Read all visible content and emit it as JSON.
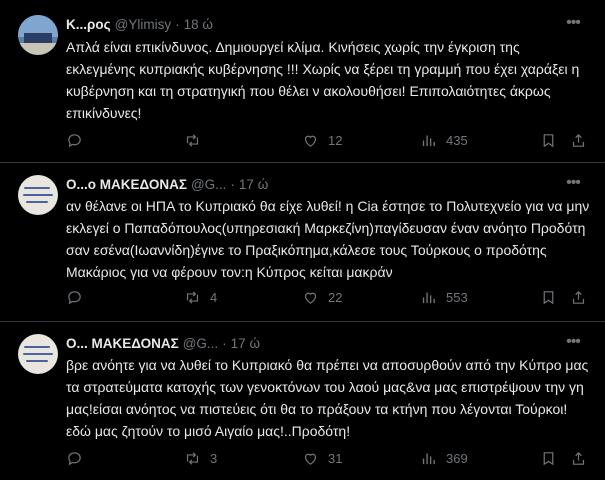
{
  "tweets": [
    {
      "name": "Κ...ρος",
      "handle": "@Ylimisy",
      "dot": "·",
      "time": "18 ώ",
      "text": "Απλά είναι επικίνδυνος. Δημιουργεί κλίμα. Κινήσεις χωρίς την έγκριση της εκλεγμένης κυπριακής κυβέρνησης !!! Χωρίς να ξέρει τη γραμμή που έχει χαράξει η κυβέρνηση και τη στρατηγική που θέλει ν ακολουθήσει! Επιπολαιότητες άκρως επικίνδυνες!",
      "replies": "",
      "retweets": "",
      "likes": "12",
      "views": "435"
    },
    {
      "name": "Ο...ο ΜΑΚΕΔΟΝΑΣ",
      "handle": "@G...",
      "dot": "·",
      "time": "17 ώ",
      "text": "αν θέλανε οι ΗΠΑ το Κυπριακό θα είχε λυθεί! η Cia έστησε το Πολυτεχνείο για να μην εκλεγεί ο Παπαδόπουλος(υπηρεσιακή  Μαρκεζίνη)παγίδευσαν έναν ανόητο Προδότη σαν εσένα(Ιωαννίδη)έγινε το Πραξικόπημα,κάλεσε τους Τούρκους ο προδότης Μακάριος για να φέρουν τον:η Κύπρος κείται μακράν",
      "replies": "",
      "retweets": "4",
      "likes": "22",
      "views": "553"
    },
    {
      "name": "Ο... ΜΑΚΕΔΟΝΑΣ",
      "handle": "@G...",
      "dot": "·",
      "time": "17 ώ",
      "text": "βρε ανόητε για  να λυθεί το Κυπριακό θα πρέπει να αποσυρθούν από την Κύπρο μας τα στρατεύματα κατοχής των γενοκτόνων του λαού μας&να μας επιστρέψουν την γη μας!είσαι ανόητος να πιστεύεις ότι θα το πράξουν τα κτήνη που λέγονται Τούρκοι!εδώ μας ζητούν το μισό Αιγαίο μας!..Προδότη!",
      "replies": "",
      "retweets": "3",
      "likes": "31",
      "views": "369"
    }
  ],
  "icons": {
    "more": "more-icon",
    "reply": "reply-icon",
    "retweet": "retweet-icon",
    "like": "heart-icon",
    "views": "views-icon",
    "bookmark": "bookmark-icon",
    "share": "share-icon"
  },
  "colors": {
    "background": "#000000",
    "text": "#e7e9ea",
    "muted": "#71767b",
    "divider": "#2f3336"
  }
}
